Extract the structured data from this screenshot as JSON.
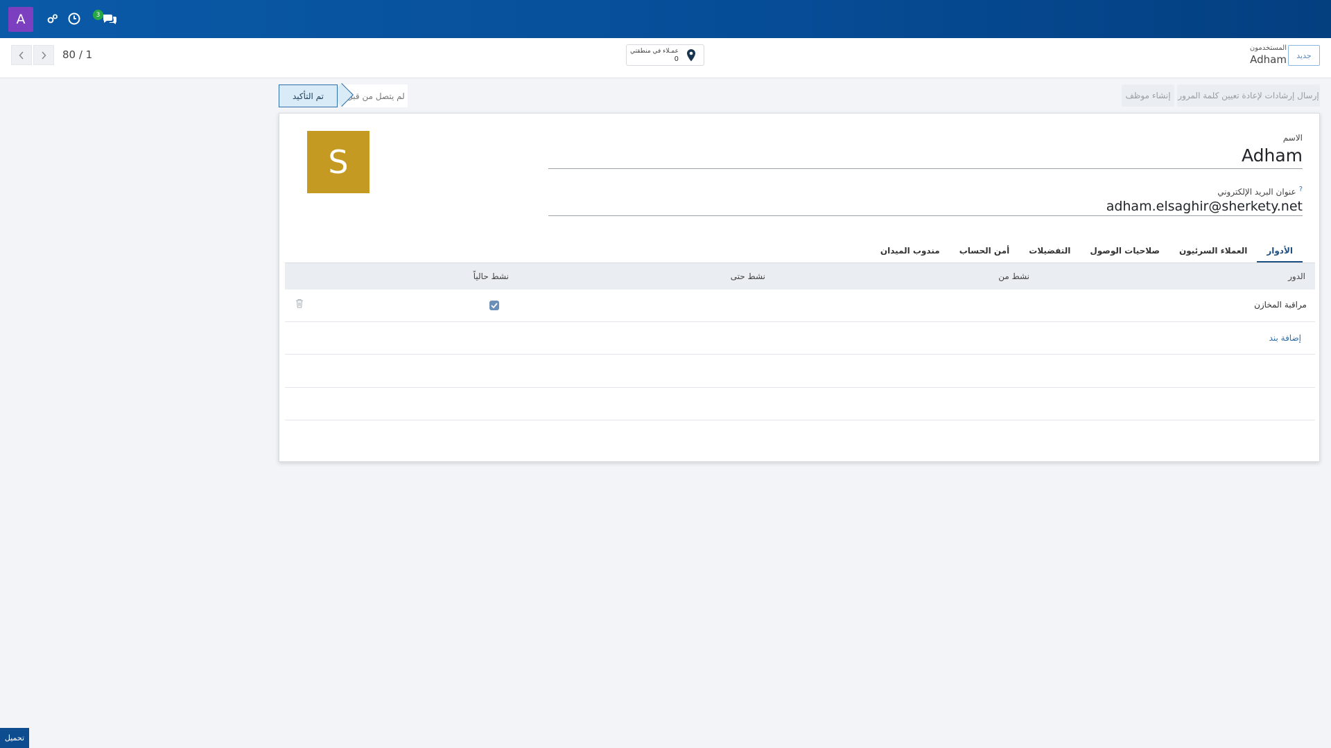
{
  "navbar": {
    "avatar_letter": "A",
    "messages_badge": "3",
    "colors": {
      "background": "#064c96",
      "avatar": "#7b3fbf",
      "badge": "#28a745"
    },
    "icons": [
      "settings-cogs-icon",
      "clock-icon",
      "chat-icon"
    ]
  },
  "control_panel": {
    "pager_text": "80 / 1",
    "geo_smart_button": {
      "label": "عمـلاء في منطقتي",
      "count": "0"
    },
    "breadcrumb": {
      "parent": "المستخدمون",
      "current": "Adham"
    },
    "new_button": "جديد"
  },
  "statusbar": {
    "buttons": [
      "إرسال إرشادات لإعادة تعيين كلمة المرور",
      "إنشاء موظف"
    ],
    "stages": {
      "current": "تم التأكيد",
      "other": "لم يتصل من قبل"
    }
  },
  "form": {
    "image_letter": "S",
    "image_color": "#c59a23",
    "name_label": "الاسم",
    "name_value": "Adham",
    "email_label": "عنوان البريد الإلكتروني",
    "email_help": "?",
    "email_value": "adham.elsaghir@sherkety.net",
    "tabs": [
      "الأدوار",
      "العملاء السرئيون",
      "صلاحيات الوصول",
      "التفضيلات",
      "أمن الحساب",
      "مندوب الميدان"
    ],
    "active_tab": "الأدوار",
    "table": {
      "columns": [
        "الدور",
        "نشط من",
        "نشط حتى",
        "نشط حالياً"
      ],
      "rows": [
        {
          "role": "مراقبة المخازن",
          "active_from": "",
          "active_to": "",
          "currently_active": true
        }
      ],
      "add_line": "إضافة بند"
    }
  },
  "footer": {
    "button": "تحميل"
  }
}
